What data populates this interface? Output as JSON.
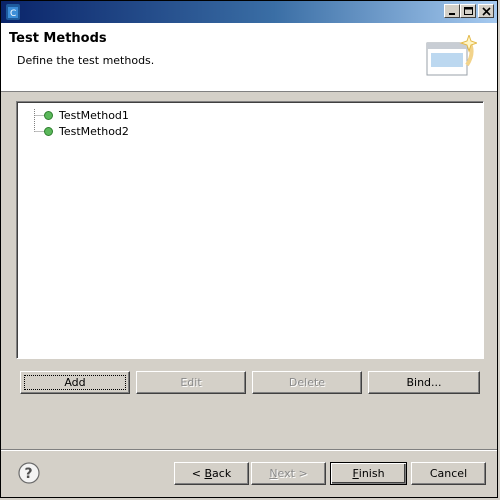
{
  "titlebar": {
    "icon": "eclipse-app-icon",
    "buttons": [
      "minimize-icon",
      "maximize-icon",
      "close-icon"
    ]
  },
  "header": {
    "title": "Test Methods",
    "description": "Define the test methods.",
    "graphic": "wizard-banner-icon"
  },
  "tree": {
    "items": [
      {
        "label": "TestMethod1",
        "icon": "green-dot-icon"
      },
      {
        "label": "TestMethod2",
        "icon": "green-dot-icon"
      }
    ]
  },
  "actions": {
    "add": "Add",
    "edit": "Edit",
    "delete": "Delete",
    "bind": "Bind..."
  },
  "footer": {
    "help_icon": "help-icon",
    "back_prefix": "< ",
    "back_mnemonic": "B",
    "back_rest": "ack",
    "next_mnemonic": "N",
    "next_rest": "ext >",
    "finish_mnemonic": "F",
    "finish_rest": "inish",
    "cancel": "Cancel"
  }
}
